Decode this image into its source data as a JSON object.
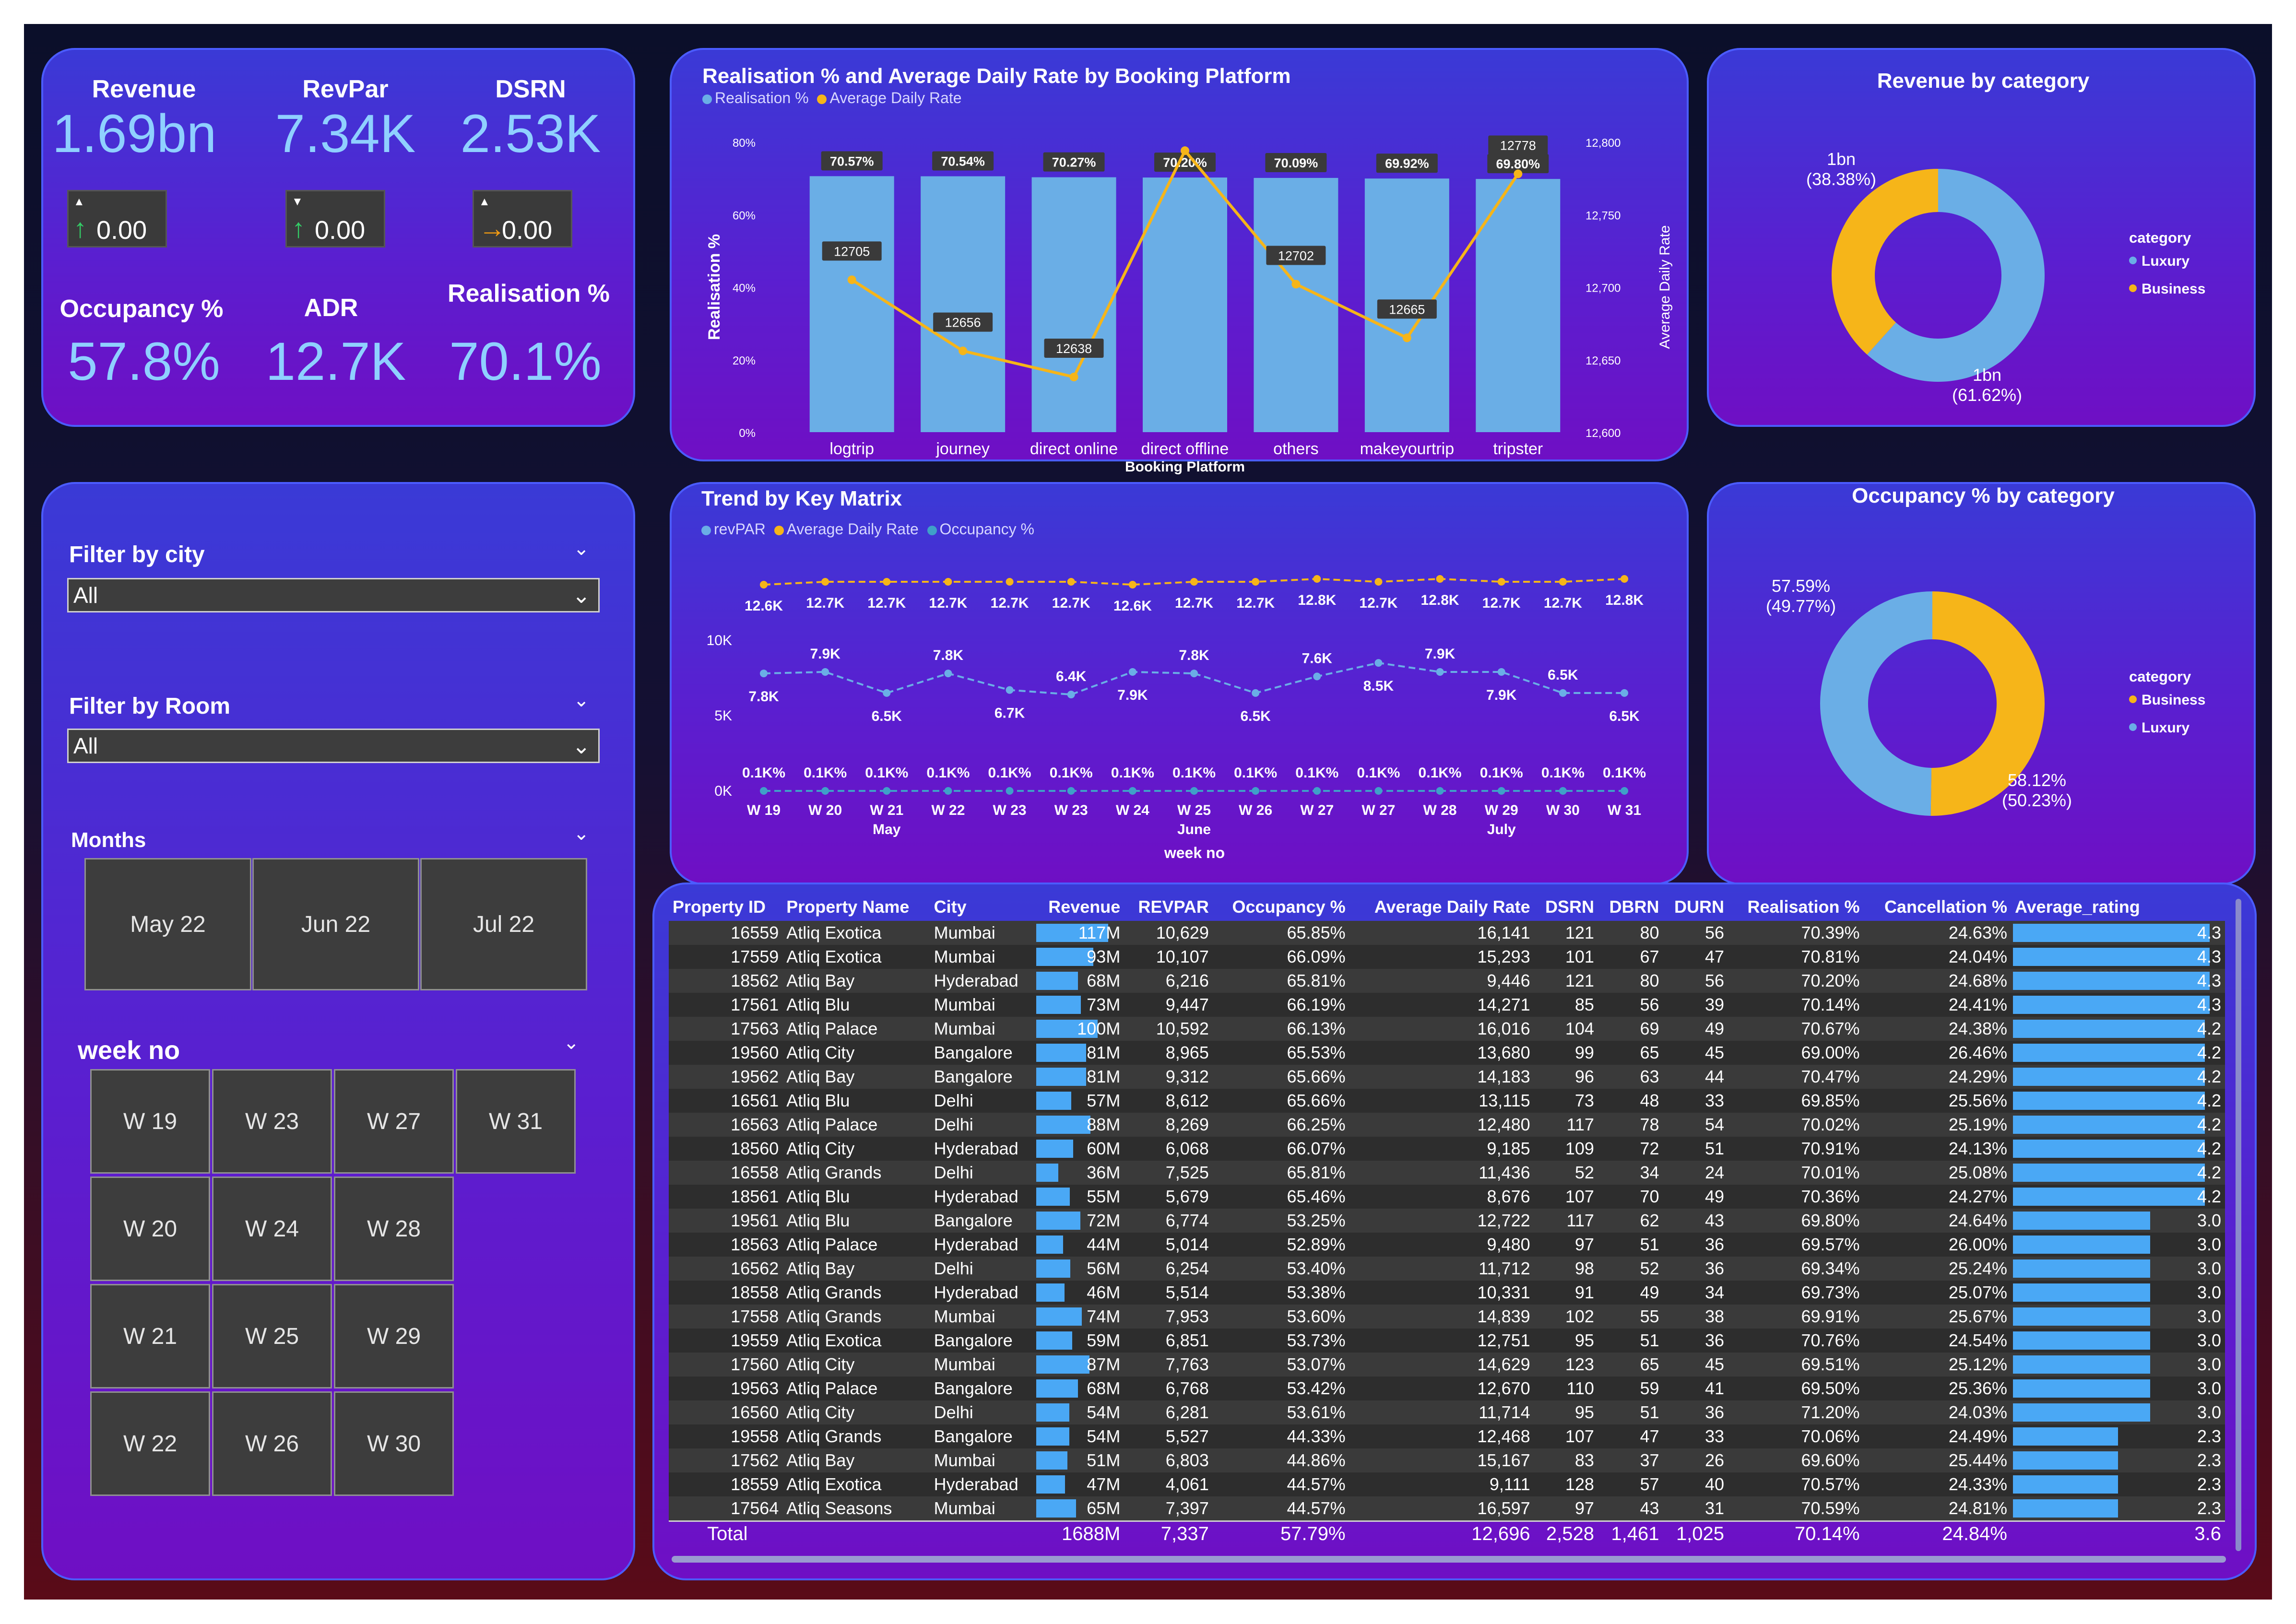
{
  "kpis": {
    "revenue": {
      "label": "Revenue",
      "value": "1.69bn",
      "delta": "0.00"
    },
    "revpar": {
      "label": "RevPar",
      "value": "7.34K",
      "delta": "0.00"
    },
    "dsrn": {
      "label": "DSRN",
      "value": "2.53K",
      "delta": "0.00"
    },
    "occupancy": {
      "label": "Occupancy %",
      "value": "57.8%"
    },
    "adr": {
      "label": "ADR",
      "value": "12.7K"
    },
    "realisation": {
      "label": "Realisation %",
      "value": "70.1%"
    }
  },
  "colors": {
    "blue": "#6aaee6",
    "orange": "#f6b519",
    "accent": "#4aa8f5"
  },
  "filters": {
    "city": {
      "label": "Filter by city",
      "value": "All"
    },
    "room": {
      "label": "Filter by Room",
      "value": "All"
    },
    "months": {
      "label": "Months",
      "items": [
        "May 22",
        "Jun 22",
        "Jul 22"
      ]
    },
    "week": {
      "label": "week no",
      "items": [
        "W 19",
        "W 23",
        "W 27",
        "W 31",
        "W 20",
        "W 24",
        "W 28",
        "W 21",
        "W 25",
        "W 29",
        "W 22",
        "W 26",
        "W 30"
      ]
    }
  },
  "chart_data": [
    {
      "type": "bar",
      "title": "Realisation % and Average Daily Rate by Booking Platform",
      "legend": [
        "Realisation %",
        "Average Daily Rate"
      ],
      "xlabel": "Booking Platform",
      "ylabel": "Realisation %",
      "y2label": "Average Daily Rate",
      "categories": [
        "logtrip",
        "journey",
        "direct online",
        "direct offline",
        "others",
        "makeyourtrip",
        "tripster"
      ],
      "y_ticks": [
        "0%",
        "20%",
        "40%",
        "60%",
        "80%"
      ],
      "y2_ticks": [
        "12,600",
        "12,650",
        "12,700",
        "12,750",
        "12,800"
      ],
      "ylim": [
        0,
        80
      ],
      "y2lim": [
        12600,
        12800
      ],
      "series": [
        {
          "name": "Realisation %",
          "type": "bar",
          "values": [
            70.57,
            70.54,
            70.27,
            70.2,
            70.09,
            69.92,
            69.8
          ],
          "labels": [
            "70.57%",
            "70.54%",
            "70.27%",
            "70.20%",
            "70.09%",
            "69.92%",
            "69.80%"
          ]
        },
        {
          "name": "Average Daily Rate",
          "type": "line",
          "values": [
            12705,
            12656,
            12638,
            12794,
            12702,
            12665,
            12778
          ],
          "labels": [
            "12705",
            "12656",
            "12638",
            "",
            "12702",
            "12665",
            "12778"
          ]
        }
      ]
    },
    {
      "type": "pie",
      "title": "Revenue by category",
      "legend_title": "category",
      "slices": [
        {
          "name": "Luxury",
          "value": 61.62,
          "label": "1bn",
          "pct": "(61.62%)"
        },
        {
          "name": "Business",
          "value": 38.38,
          "label": "1bn",
          "pct": "(38.38%)"
        }
      ]
    },
    {
      "type": "line",
      "title": "Trend by Key Matrix",
      "legend": [
        "revPAR",
        "Average Daily Rate",
        "Occupancy %"
      ],
      "xlabel": "week no",
      "categories": [
        "W 19",
        "W 20",
        "W 21",
        "W 22",
        "W 23",
        "W 23",
        "W 24",
        "W 25",
        "W 26",
        "W 27",
        "W 27",
        "W 28",
        "W 29",
        "W 30",
        "W 31"
      ],
      "month_labels": [
        {
          "at": "W 21",
          "label": "May"
        },
        {
          "at": "W 25",
          "label": "June"
        },
        {
          "at": "W 29",
          "label": "July"
        }
      ],
      "y_ticks": [
        "0K",
        "5K",
        "10K"
      ],
      "ylim": [
        0,
        11000
      ],
      "series": [
        {
          "name": "Average Daily Rate",
          "values": [
            12600,
            12700,
            12700,
            12700,
            12700,
            12700,
            12600,
            12700,
            12700,
            12800,
            12700,
            12800,
            12700,
            12700,
            12800
          ],
          "labels": [
            "12.6K",
            "12.7K",
            "12.7K",
            "12.7K",
            "12.7K",
            "12.7K",
            "12.6K",
            "12.7K",
            "12.7K",
            "12.8K",
            "12.7K",
            "12.8K",
            "12.7K",
            "12.7K",
            "12.8K"
          ]
        },
        {
          "name": "revPAR",
          "values": [
            7800,
            7900,
            6500,
            7800,
            6700,
            6400,
            7900,
            7800,
            6500,
            7600,
            8500,
            7900,
            7900,
            6500,
            6500
          ],
          "labels": [
            "7.8K",
            "7.9K",
            "6.5K",
            "7.8K",
            "6.7K",
            "6.4K",
            "7.9K",
            "7.8K",
            "6.5K",
            "7.6K",
            "8.5K",
            "7.9K",
            "7.9K",
            "6.5K",
            "6.5K"
          ]
        },
        {
          "name": "Occupancy %",
          "values": [
            100,
            100,
            100,
            100,
            100,
            100,
            100,
            100,
            100,
            100,
            100,
            100,
            100,
            100,
            100
          ],
          "labels": [
            "0.1K%",
            "0.1K%",
            "0.1K%",
            "0.1K%",
            "0.1K%",
            "0.1K%",
            "0.1K%",
            "0.1K%",
            "0.1K%",
            "0.1K%",
            "0.1K%",
            "0.1K%",
            "0.1K%",
            "0.1K%",
            "0.1K%"
          ]
        }
      ]
    },
    {
      "type": "pie",
      "title": "Occupancy % by category",
      "legend_title": "category",
      "slices": [
        {
          "name": "Business",
          "value": 50.23,
          "label": "58.12%",
          "pct": "(50.23%)"
        },
        {
          "name": "Luxury",
          "value": 49.77,
          "label": "57.59%",
          "pct": "(49.77%)"
        }
      ]
    }
  ],
  "table": {
    "headers": [
      "Property ID",
      "Property Name",
      "City",
      "Revenue",
      "REVPAR",
      "Occupancy %",
      "Average Daily Rate",
      "DSRN",
      "DBRN",
      "DURN",
      "Realisation %",
      "Cancellation %",
      "Average_rating"
    ],
    "revenue_max": 117,
    "rating_max": 4.3,
    "rows": [
      [
        "16559",
        "Atliq Exotica",
        "Mumbai",
        "117M",
        "10,629",
        "65.85%",
        "16,141",
        "121",
        "80",
        "56",
        "70.39%",
        "24.63%",
        "4.3"
      ],
      [
        "17559",
        "Atliq Exotica",
        "Mumbai",
        "93M",
        "10,107",
        "66.09%",
        "15,293",
        "101",
        "67",
        "47",
        "70.81%",
        "24.04%",
        "4.3"
      ],
      [
        "18562",
        "Atliq Bay",
        "Hyderabad",
        "68M",
        "6,216",
        "65.81%",
        "9,446",
        "121",
        "80",
        "56",
        "70.20%",
        "24.68%",
        "4.3"
      ],
      [
        "17561",
        "Atliq Blu",
        "Mumbai",
        "73M",
        "9,447",
        "66.19%",
        "14,271",
        "85",
        "56",
        "39",
        "70.14%",
        "24.41%",
        "4.3"
      ],
      [
        "17563",
        "Atliq Palace",
        "Mumbai",
        "100M",
        "10,592",
        "66.13%",
        "16,016",
        "104",
        "69",
        "49",
        "70.67%",
        "24.38%",
        "4.2"
      ],
      [
        "19560",
        "Atliq City",
        "Bangalore",
        "81M",
        "8,965",
        "65.53%",
        "13,680",
        "99",
        "65",
        "45",
        "69.00%",
        "26.46%",
        "4.2"
      ],
      [
        "19562",
        "Atliq Bay",
        "Bangalore",
        "81M",
        "9,312",
        "65.66%",
        "14,183",
        "96",
        "63",
        "44",
        "70.47%",
        "24.29%",
        "4.2"
      ],
      [
        "16561",
        "Atliq Blu",
        "Delhi",
        "57M",
        "8,612",
        "65.66%",
        "13,115",
        "73",
        "48",
        "33",
        "69.85%",
        "25.56%",
        "4.2"
      ],
      [
        "16563",
        "Atliq Palace",
        "Delhi",
        "88M",
        "8,269",
        "66.25%",
        "12,480",
        "117",
        "78",
        "54",
        "70.02%",
        "25.19%",
        "4.2"
      ],
      [
        "18560",
        "Atliq City",
        "Hyderabad",
        "60M",
        "6,068",
        "66.07%",
        "9,185",
        "109",
        "72",
        "51",
        "70.91%",
        "24.13%",
        "4.2"
      ],
      [
        "16558",
        "Atliq Grands",
        "Delhi",
        "36M",
        "7,525",
        "65.81%",
        "11,436",
        "52",
        "34",
        "24",
        "70.01%",
        "25.08%",
        "4.2"
      ],
      [
        "18561",
        "Atliq Blu",
        "Hyderabad",
        "55M",
        "5,679",
        "65.46%",
        "8,676",
        "107",
        "70",
        "49",
        "70.36%",
        "24.27%",
        "4.2"
      ],
      [
        "19561",
        "Atliq Blu",
        "Bangalore",
        "72M",
        "6,774",
        "53.25%",
        "12,722",
        "117",
        "62",
        "43",
        "69.80%",
        "24.64%",
        "3.0"
      ],
      [
        "18563",
        "Atliq Palace",
        "Hyderabad",
        "44M",
        "5,014",
        "52.89%",
        "9,480",
        "97",
        "51",
        "36",
        "69.57%",
        "26.00%",
        "3.0"
      ],
      [
        "16562",
        "Atliq Bay",
        "Delhi",
        "56M",
        "6,254",
        "53.40%",
        "11,712",
        "98",
        "52",
        "36",
        "69.34%",
        "25.24%",
        "3.0"
      ],
      [
        "18558",
        "Atliq Grands",
        "Hyderabad",
        "46M",
        "5,514",
        "53.38%",
        "10,331",
        "91",
        "49",
        "34",
        "69.73%",
        "25.07%",
        "3.0"
      ],
      [
        "17558",
        "Atliq Grands",
        "Mumbai",
        "74M",
        "7,953",
        "53.60%",
        "14,839",
        "102",
        "55",
        "38",
        "69.91%",
        "25.67%",
        "3.0"
      ],
      [
        "19559",
        "Atliq Exotica",
        "Bangalore",
        "59M",
        "6,851",
        "53.73%",
        "12,751",
        "95",
        "51",
        "36",
        "70.76%",
        "24.54%",
        "3.0"
      ],
      [
        "17560",
        "Atliq City",
        "Mumbai",
        "87M",
        "7,763",
        "53.07%",
        "14,629",
        "123",
        "65",
        "45",
        "69.51%",
        "25.12%",
        "3.0"
      ],
      [
        "19563",
        "Atliq Palace",
        "Bangalore",
        "68M",
        "6,768",
        "53.42%",
        "12,670",
        "110",
        "59",
        "41",
        "69.50%",
        "25.36%",
        "3.0"
      ],
      [
        "16560",
        "Atliq City",
        "Delhi",
        "54M",
        "6,281",
        "53.61%",
        "11,714",
        "95",
        "51",
        "36",
        "71.20%",
        "24.03%",
        "3.0"
      ],
      [
        "19558",
        "Atliq Grands",
        "Bangalore",
        "54M",
        "5,527",
        "44.33%",
        "12,468",
        "107",
        "47",
        "33",
        "70.06%",
        "24.49%",
        "2.3"
      ],
      [
        "17562",
        "Atliq Bay",
        "Mumbai",
        "51M",
        "6,803",
        "44.86%",
        "15,167",
        "83",
        "37",
        "26",
        "69.60%",
        "25.44%",
        "2.3"
      ],
      [
        "18559",
        "Atliq Exotica",
        "Hyderabad",
        "47M",
        "4,061",
        "44.57%",
        "9,111",
        "128",
        "57",
        "40",
        "70.57%",
        "24.33%",
        "2.3"
      ],
      [
        "17564",
        "Atliq Seasons",
        "Mumbai",
        "65M",
        "7,397",
        "44.57%",
        "16,597",
        "97",
        "43",
        "31",
        "70.59%",
        "24.81%",
        "2.3"
      ]
    ],
    "total": [
      "Total",
      "",
      "",
      "1688M",
      "7,337",
      "57.79%",
      "12,696",
      "2,528",
      "1,461",
      "1,025",
      "70.14%",
      "24.84%",
      "3.6"
    ]
  }
}
